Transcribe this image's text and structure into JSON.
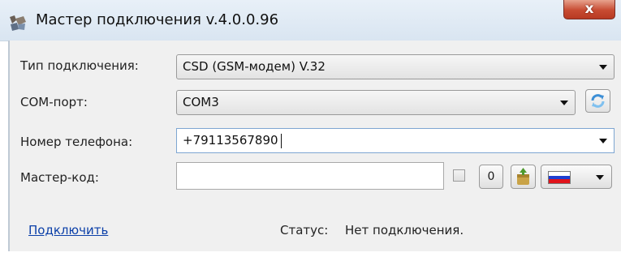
{
  "window": {
    "title": "Мастер подключения v.4.0.0.96",
    "close_label": "x"
  },
  "form": {
    "connection_type": {
      "label": "Тип подключения:",
      "value": "CSD (GSM-модем) V.32"
    },
    "com_port": {
      "label": "COM-порт:",
      "value": "COM3"
    },
    "phone_number": {
      "label": "Номер телефона:",
      "value": "+79113567890"
    },
    "master_code": {
      "label": "Мастер-код:",
      "value": "",
      "checkbox_checked": false,
      "zero_button_label": "0"
    },
    "language_flag": {
      "colors": [
        "#ffffff",
        "#1e3fd1",
        "#e0131b"
      ]
    }
  },
  "footer": {
    "connect_link": "Подключить",
    "status_label": "Статус:",
    "status_value": "Нет подключения."
  },
  "colors": {
    "link": "#0b3fa8",
    "close_button": "#c74b32"
  }
}
